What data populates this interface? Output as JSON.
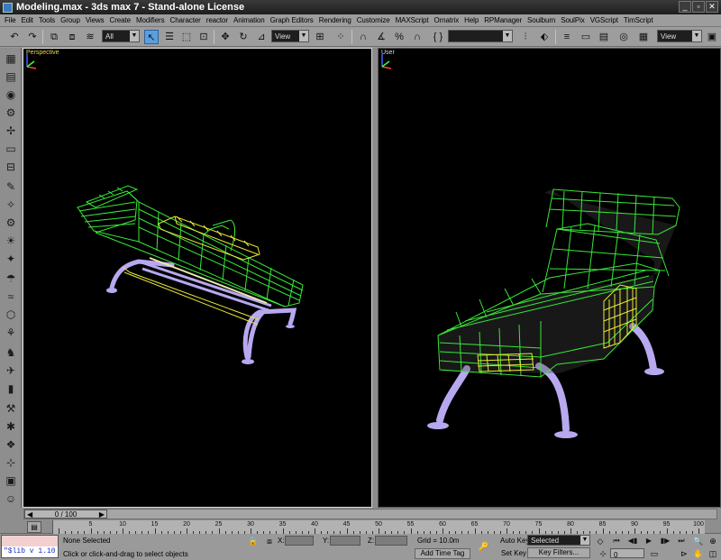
{
  "window": {
    "title": "Modeling.max - 3ds max 7  - Stand-alone License"
  },
  "menu": [
    "File",
    "Edit",
    "Tools",
    "Group",
    "Views",
    "Create",
    "Modifiers",
    "Character",
    "reactor",
    "Animation",
    "Graph Editors",
    "Rendering",
    "Customize",
    "MAXScript",
    "Ornatrix",
    "Help",
    "RPManager",
    "Soulburn",
    "SoulPix",
    "VGScript",
    "TimScript"
  ],
  "toolbar": {
    "selection_filter": "All",
    "reference_coord": "View",
    "named_selection": "",
    "right_view": "View"
  },
  "viewports": {
    "left_label": "Perspective",
    "right_label": "User"
  },
  "timeslider": {
    "frame_label": "0 / 100"
  },
  "ruler": {
    "ticks": [
      "5",
      "10",
      "15",
      "20",
      "25",
      "30",
      "35",
      "40",
      "45",
      "50",
      "55",
      "60",
      "65",
      "70",
      "75",
      "80",
      "85",
      "90",
      "95",
      "100"
    ]
  },
  "status": {
    "maxscript_text": "\"$lib v 1.10",
    "selection": "None Selected",
    "prompt": "Click or click-and-drag to select objects",
    "x_label": "X:",
    "y_label": "Y:",
    "z_label": "Z:",
    "grid": "Grid = 10.0m",
    "add_time_tag": "Add Time Tag",
    "auto_key": "Auto Key",
    "auto_key_mode": "Selected",
    "set_key": "Set Key",
    "key_filters": "Key Filters...",
    "current_frame": "0"
  },
  "colors": {
    "wire_green": "#38e838",
    "wire_yellow": "#e8e838",
    "legs_lavender": "#b8a8f0",
    "active_viewport_label": "#f0d64a"
  }
}
